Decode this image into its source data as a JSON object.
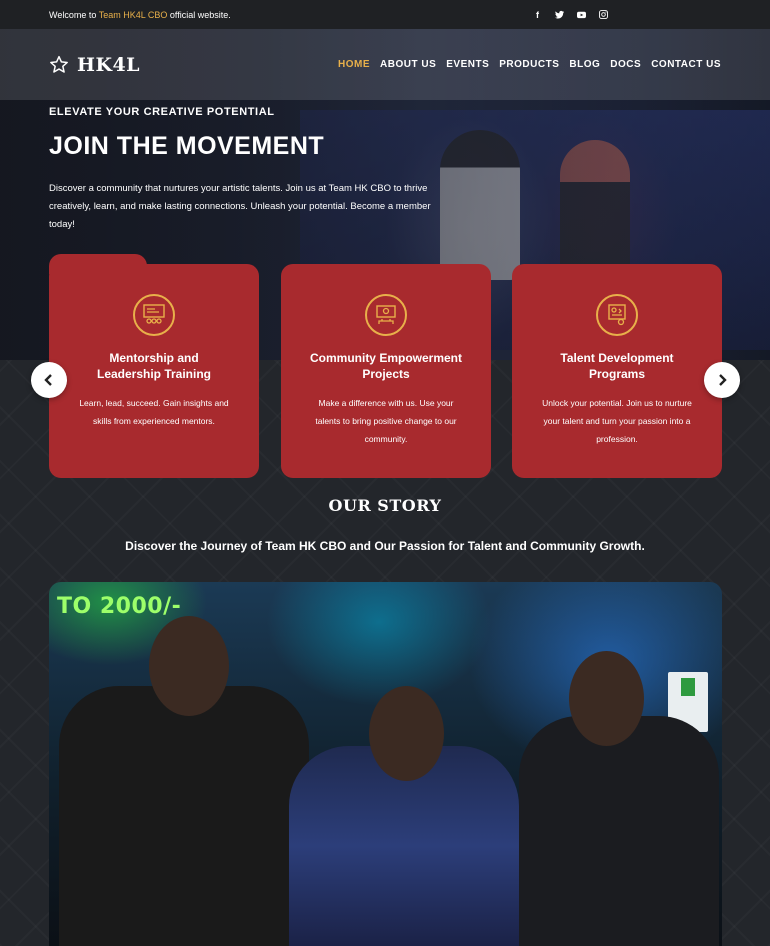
{
  "topbar": {
    "welcome_prefix": "Welcome to ",
    "welcome_highlight": "Team HK4L CBO",
    "welcome_suffix": " official website.",
    "socials": [
      "facebook-icon",
      "twitter-icon",
      "youtube-icon",
      "instagram-icon"
    ]
  },
  "brand": {
    "name": "HK4L"
  },
  "nav": {
    "items": [
      "HOME",
      "ABOUT US",
      "EVENTS",
      "PRODUCTS",
      "BLOG",
      "DOCS",
      "CONTACT US"
    ],
    "active": "HOME"
  },
  "hero": {
    "kicker": "ELEVATE YOUR CREATIVE POTENTIAL",
    "headline": "JOIN THE MOVEMENT",
    "lead": "Discover a community that nurtures your artistic talents. Join us at Team HK CBO to thrive creatively, learn, and make lasting connections. Unleash your potential. Become a member today!"
  },
  "cards": [
    {
      "title": "Mentorship and Leadership Training",
      "desc": "Learn, lead, succeed. Gain insights and skills from experienced mentors.",
      "icon": "mentorship-icon"
    },
    {
      "title": "Community Empowerment Projects",
      "desc": "Make a difference with us. Use your talents to bring positive change to our community.",
      "icon": "community-icon"
    },
    {
      "title": "Talent Development Programs",
      "desc": "Unlock your potential. Join us to nurture your talent and turn your passion into a profession.",
      "icon": "talent-icon"
    }
  ],
  "story": {
    "title": "OUR STORY",
    "subtitle": "Discover the Journey of Team HK CBO and Our Passion for Talent and Community Growth.",
    "photo_text": "TO 2000/-"
  },
  "colors": {
    "accent": "#e8b04a",
    "card": "#a82a2e",
    "background": "#23262b"
  }
}
